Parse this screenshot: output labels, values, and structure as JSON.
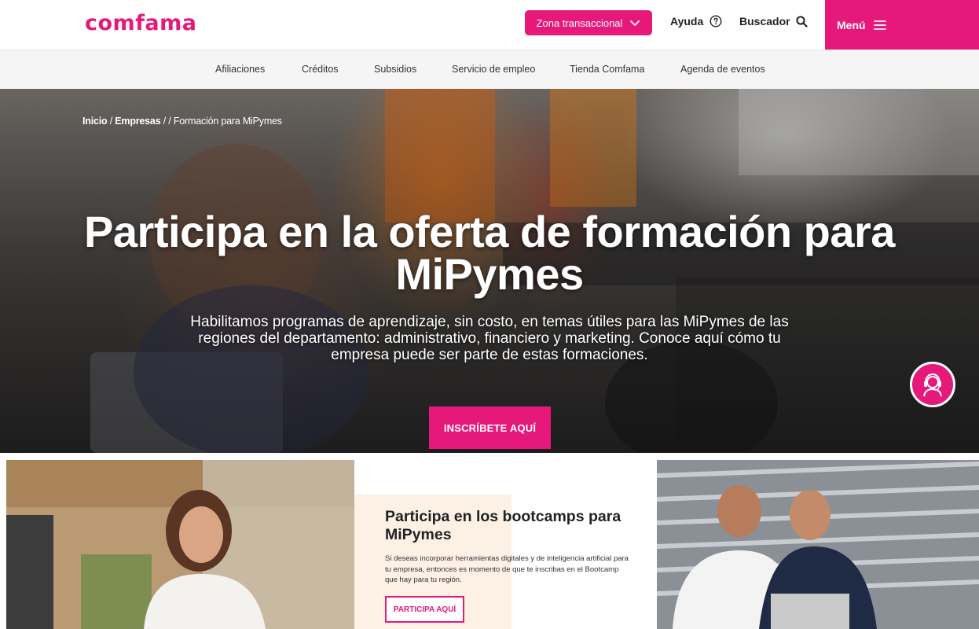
{
  "header": {
    "logo_text": "comfama",
    "transactional_button": "Zona transaccional",
    "help_label": "Ayuda",
    "search_label": "Buscador",
    "menu_label": "Menú",
    "icons": {
      "transactional": "chevron-down-icon",
      "help": "help-circle-icon",
      "search": "search-icon",
      "menu": "hamburger-menu-icon"
    }
  },
  "subnav": {
    "items": [
      {
        "label": "Afiliaciones"
      },
      {
        "label": "Créditos"
      },
      {
        "label": "Subsidios"
      },
      {
        "label": "Servicio de empleo"
      },
      {
        "label": "Tienda Comfama"
      },
      {
        "label": "Agenda de eventos"
      }
    ]
  },
  "breadcrumb": {
    "home": "Inicio",
    "sep1": " / ",
    "section": "Empresas",
    "sep2": " / / ",
    "current": "Formación para MiPymes"
  },
  "hero": {
    "title": "Participa en la oferta de formación para MiPymes",
    "description": "Habilitamos programas de aprendizaje, sin costo, en temas útiles para las MiPymes de las regiones del departamento: administrativo, financiero y marketing. Conoce aquí cómo tu empresa puede ser parte de estas formaciones.",
    "cta_label": "INSCRÍBETE AQUÍ",
    "support_icon": "customer-support-headset-icon"
  },
  "bootcamp_card": {
    "title": "Participa en los bootcamps para MiPymes",
    "text": "Si deseas incorporar herramientas digitales y de inteligencia artificial para tu empresa, entonces es momento de que te inscribas en el Bootcamp que hay para tu región.",
    "cta_label": "PARTICIPA AQUÍ"
  },
  "colors": {
    "brand_pink": "#e6197b",
    "accent_cream": "#fdf1e6",
    "subnav_bg": "#f5f5f5"
  }
}
